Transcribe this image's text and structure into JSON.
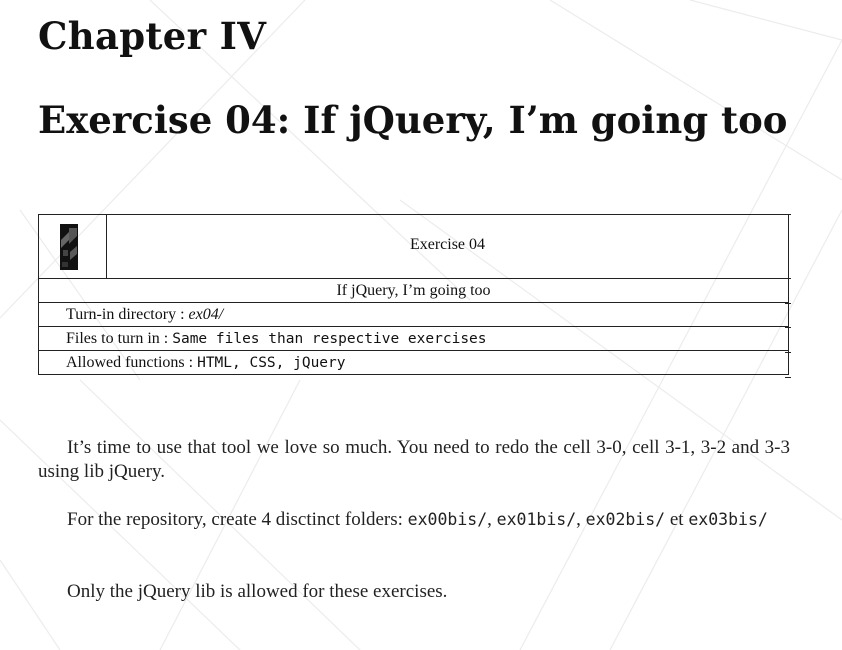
{
  "chapter": {
    "title": "Chapter IV"
  },
  "exercise": {
    "heading": "Exercise 04: If jQuery, I’m going too"
  },
  "table": {
    "exercise_label": "Exercise 04",
    "subtitle": "If jQuery, I’m going too",
    "turnin_label": "Turn-in directory : ",
    "turnin_value": "ex04/",
    "files_label": "Files to turn in : ",
    "files_value": "Same files than respective exercises",
    "allowed_label": "Allowed functions : ",
    "allowed_value": "HTML, CSS, jQuery",
    "logo_icon": "42-logo-icon"
  },
  "body": {
    "p1": "It’s time to use that tool we love so much. You need to redo the cell 3-0, cell 3-1, 3-2 and 3-3 using lib jQuery.",
    "p2_prefix": "For the repository, create 4 disctinct folders: ",
    "p2_f1": "ex00bis/",
    "p2_sep1": ", ",
    "p2_f2": "ex01bis/",
    "p2_sep2": ", ",
    "p2_f3": "ex02bis/",
    "p2_et": " et ",
    "p2_f4": "ex03bis/",
    "p3": "Only the jQuery lib is allowed for these exercises."
  },
  "colors": {
    "text": "#111111",
    "background": "#ffffff",
    "decor_lines": "#e9e9e9"
  }
}
